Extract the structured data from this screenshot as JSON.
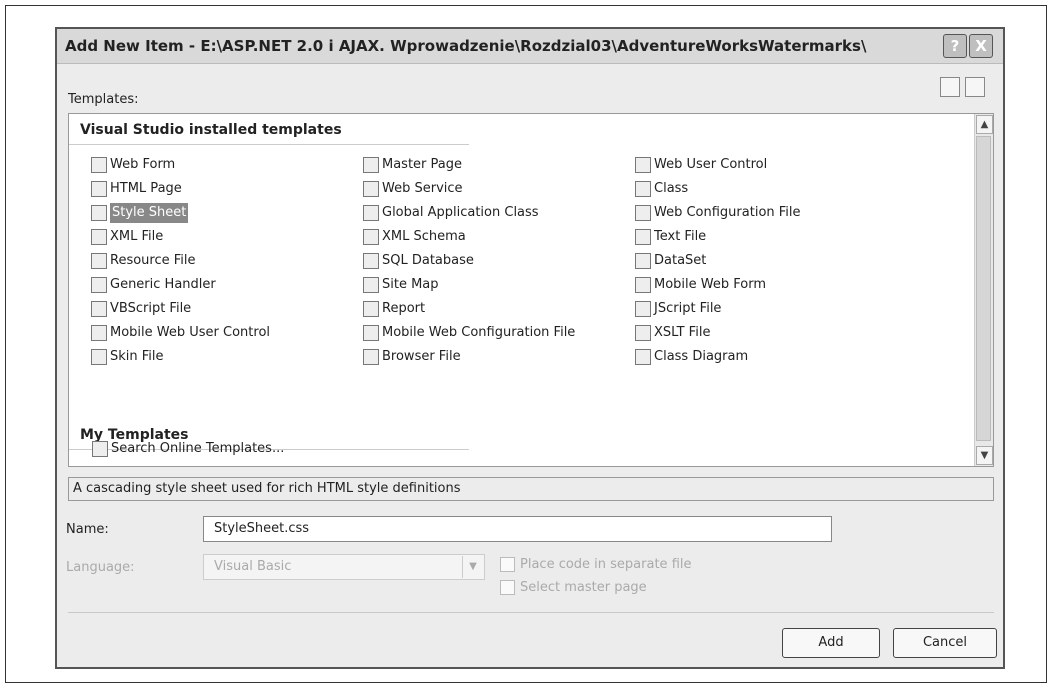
{
  "dialog": {
    "title": "Add New Item - E:\\ASP.NET 2.0 i AJAX. Wprowadzenie\\Rozdzial03\\AdventureWorksWatermarks\\",
    "help_label": "?",
    "close_label": "X"
  },
  "templates_label": "Templates:",
  "installed_section": "Visual Studio installed templates",
  "installed_items": [
    "Web Form",
    "HTML Page",
    "Style Sheet",
    "XML File",
    "Resource File",
    "Generic Handler",
    "VBScript File",
    "Mobile Web User Control",
    "Skin File",
    "Master Page",
    "Web Service",
    "Global Application Class",
    "XML Schema",
    "SQL Database",
    "Site Map",
    "Report",
    "Mobile Web Configuration File",
    "Browser File",
    "Web User Control",
    "Class",
    "Web Configuration File",
    "Text File",
    "DataSet",
    "Mobile Web Form",
    "JScript File",
    "XSLT File",
    "Class Diagram"
  ],
  "selected_item": "Style Sheet",
  "my_section": "My Templates",
  "my_items": [
    "Search Online Templates..."
  ],
  "description": "A cascading style sheet used for rich HTML style definitions",
  "name_label": "Name:",
  "name_value": "StyleSheet.css",
  "language_label": "Language:",
  "language_value": "Visual Basic",
  "checkbox_separate": "Place code in separate file",
  "checkbox_master": "Select master page",
  "add_label": "Add",
  "cancel_label": "Cancel"
}
